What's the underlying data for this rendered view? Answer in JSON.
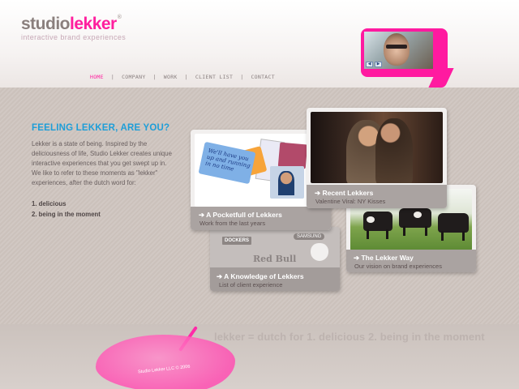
{
  "header": {
    "logo_part1": "studio",
    "logo_part2": "lekker",
    "logo_reg": "®",
    "tagline": "interactive brand experiences"
  },
  "nav": {
    "items": [
      {
        "label": "HOME",
        "active": true
      },
      {
        "label": "COMPANY",
        "active": false
      },
      {
        "label": "WORK",
        "active": false
      },
      {
        "label": "CLIENT LIST",
        "active": false
      },
      {
        "label": "CONTACT",
        "active": false
      }
    ],
    "separator": "|"
  },
  "video": {
    "buttons": [
      "◀",
      "▶"
    ]
  },
  "intro": {
    "title": "FEELING LEKKER, ARE YOU?",
    "body": "Lekker is a state of being. Inspired by the deliciousness of life, Studio Lekker creates unique interactive experiences that you get swept up in. We like to refer to these moments as \"lekker\" experiences, after the dutch word for:",
    "list": [
      "1. delicious",
      "2. being in the moment"
    ]
  },
  "cards": {
    "pocket": {
      "title": "➔ A Pocketfull of Lekkers",
      "subtitle": "Work from the last years"
    },
    "recent": {
      "title": "➔ Recent Lekkers",
      "subtitle": "Valentine Viral: NY Kisses"
    },
    "way": {
      "title": "➔ The Lekker Way",
      "subtitle": "Our vision on brand experiences"
    },
    "knowledge": {
      "title": "➔ A Knowledge of Lekkers",
      "subtitle": "List of client experience",
      "logos": [
        "DOCKERS",
        "SAMSUNG",
        "Red Bull"
      ]
    },
    "pocket_card_text": "We'll have you up and running in no time"
  },
  "footer": {
    "slogan": "lekker = dutch for 1. delicious 2. being in the moment",
    "copyright": "Studio Lekker LLC © 2006"
  },
  "colors": {
    "accent_pink": "#ff1e9e",
    "title_blue": "#1e9ed8",
    "text_gray": "#6a6060"
  }
}
